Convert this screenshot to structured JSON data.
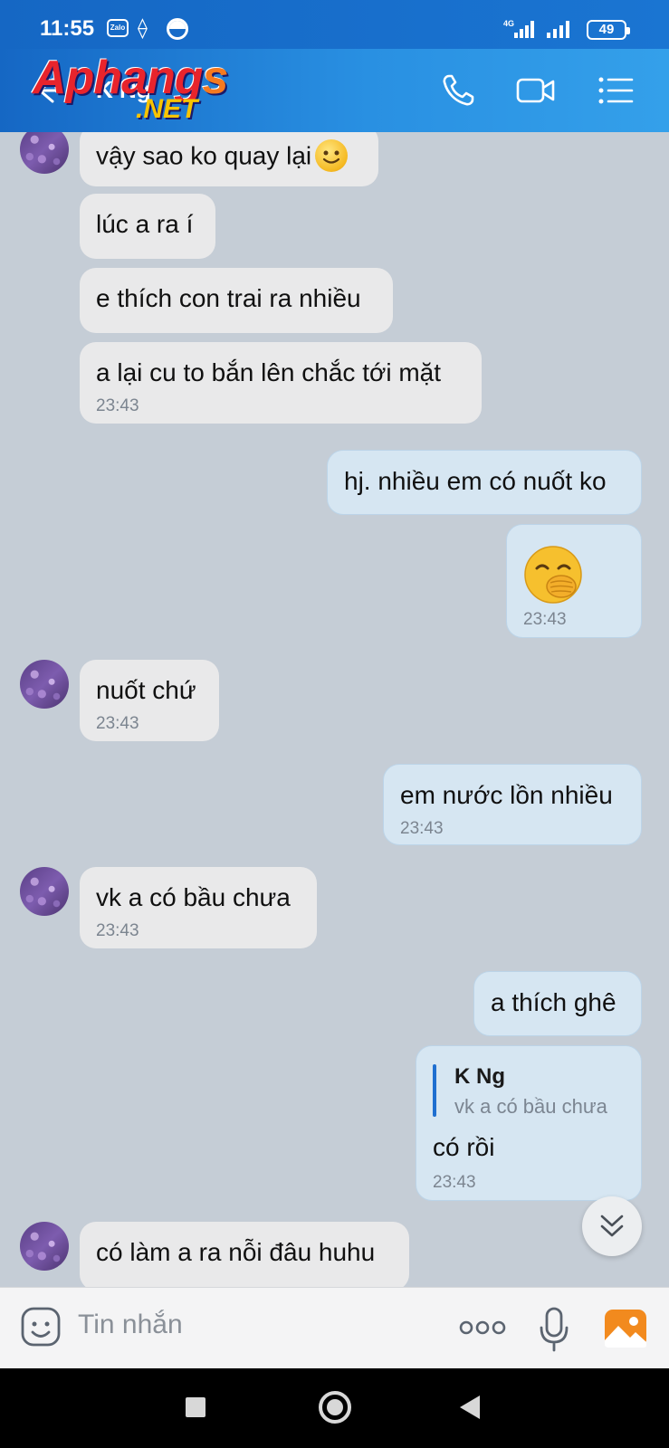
{
  "status_bar": {
    "time": "11:55",
    "zalo_label": "Zalo",
    "network_label": "4G",
    "battery": "49"
  },
  "header": {
    "contact_name": "K Ng",
    "watermark_main": "Aphang",
    "watermark_tail": "s",
    "watermark_sub": ".NET"
  },
  "messages": [
    {
      "direction": "in",
      "text": "vậy sao ko quay lại",
      "emoji": "slightly-smiling-face"
    },
    {
      "direction": "in",
      "text": "lúc a ra í"
    },
    {
      "direction": "in",
      "text": "e thích con trai ra nhiều"
    },
    {
      "direction": "in",
      "text": "a lại cu to bắn lên chắc tới mặt",
      "time": "23:43"
    },
    {
      "direction": "out",
      "text": "hj. nhiều em có nuốt ko"
    },
    {
      "direction": "out",
      "emoji": "face-with-hand-over-mouth",
      "time": "23:43"
    },
    {
      "direction": "in",
      "text": "nuốt chứ",
      "time": "23:43"
    },
    {
      "direction": "out",
      "text": "em nước lồn nhiều",
      "time": "23:43"
    },
    {
      "direction": "in",
      "text": "vk a có bầu chưa",
      "time": "23:43"
    },
    {
      "direction": "out",
      "text": "a thích ghê"
    },
    {
      "direction": "out",
      "reply_to_name": "K Ng",
      "reply_to_text": "vk a có bầu chưa",
      "text": "có rồi",
      "time": "23:43"
    },
    {
      "direction": "in",
      "text": "có làm a ra nỗi đâu huhu"
    }
  ],
  "input": {
    "placeholder": "Tin nhắn"
  },
  "colors": {
    "header_blue": "#1a75d2",
    "incoming_bubble": "#e9e9ea",
    "outgoing_bubble": "#d6e6f2",
    "chat_background": "#c5cdd6"
  }
}
